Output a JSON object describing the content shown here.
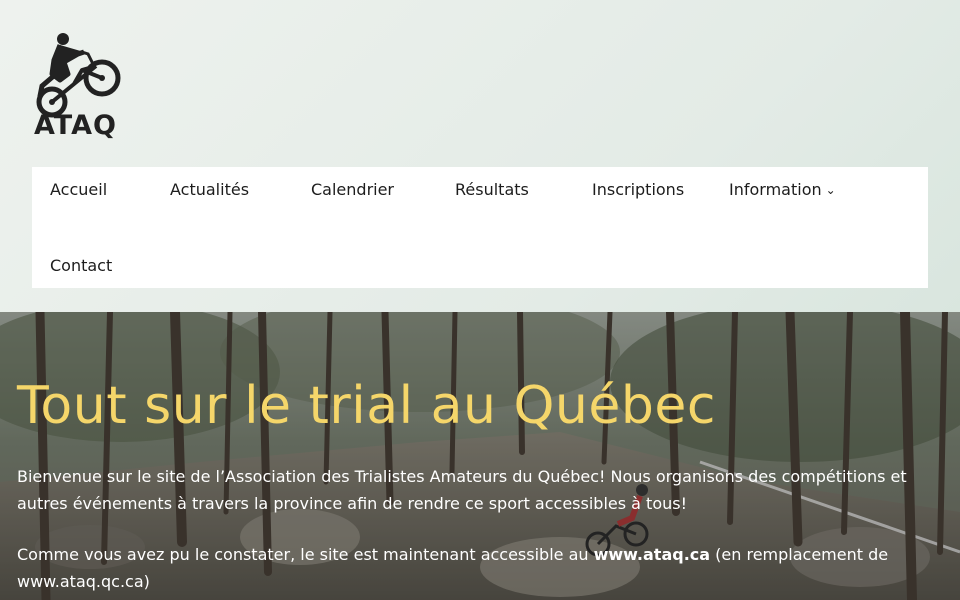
{
  "brand": {
    "logo_text": "ATAQ"
  },
  "nav": {
    "items": [
      {
        "label": "Accueil"
      },
      {
        "label": "Actualités"
      },
      {
        "label": "Calendrier"
      },
      {
        "label": "Résultats"
      },
      {
        "label": "Inscriptions"
      },
      {
        "label": "Information",
        "has_submenu": true
      },
      {
        "label": "Contact"
      }
    ]
  },
  "hero": {
    "title": "Tout sur le trial au Québec",
    "paragraph1": "Bienvenue sur le site de l’Association des Trialistes Amateurs du Québec! Nous organisons des compétitions et autres événements à travers la province afin de rendre ce sport accessibles à tous!",
    "paragraph2_prefix": "Comme vous avez pu le constater, le site est maintenant accessible au ",
    "paragraph2_link": "www.ataq.ca",
    "paragraph2_suffix": " (en remplacement de www.ataq.qc.ca)"
  },
  "colors": {
    "title_yellow": "#f5d66a",
    "nav_bg": "#ffffff",
    "page_bg": "#e3ebe6",
    "text_dark": "#1d1d1d"
  },
  "icons": {
    "logo": "trial-rider-logo",
    "submenu": "chevron-down-icon"
  }
}
